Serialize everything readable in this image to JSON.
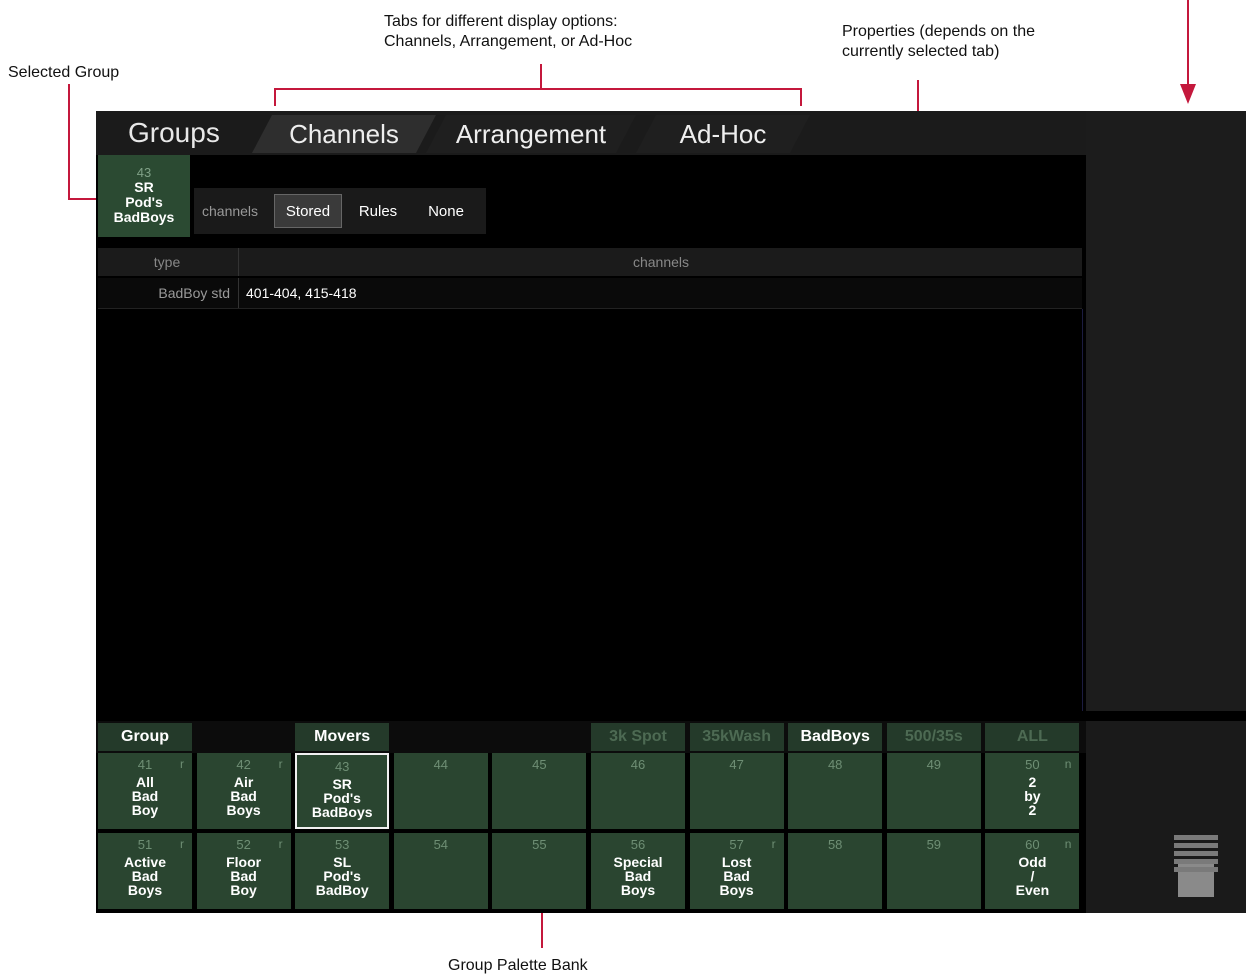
{
  "callouts": {
    "tabs_note_line1": "Tabs for different display options:",
    "tabs_note_line2": "Channels, Arrangement, or Ad-Hoc",
    "properties_note_line1": "Properties (depends on the",
    "properties_note_line2": "currently selected tab)",
    "selected_group_note": "Selected Group",
    "palette_bank_note": "Group Palette Bank"
  },
  "header": {
    "title": "Groups",
    "tabs": [
      {
        "label": "Channels",
        "active": true
      },
      {
        "label": "Arrangement",
        "active": false
      },
      {
        "label": "Ad-Hoc",
        "active": false
      }
    ]
  },
  "selected_group": {
    "number": "43",
    "name": "SR\nPod's\nBadBoys"
  },
  "channels_filter": {
    "label": "channels",
    "options": [
      {
        "label": "Stored",
        "selected": true
      },
      {
        "label": "Rules",
        "selected": false
      },
      {
        "label": "None",
        "selected": false
      }
    ]
  },
  "table": {
    "headers": [
      "type",
      "channels"
    ],
    "rows": [
      {
        "type": "BadBoy std",
        "channels": "401-404, 415-418"
      }
    ]
  },
  "bank_labels": [
    {
      "label": "Group",
      "dim": false
    },
    {
      "label": "",
      "dim": false
    },
    {
      "label": "Movers",
      "dim": false
    },
    {
      "label": "",
      "dim": false
    },
    {
      "label": "",
      "dim": false
    },
    {
      "label": "3k Spot",
      "dim": true
    },
    {
      "label": "35kWash",
      "dim": true
    },
    {
      "label": "BadBoys",
      "dim": false
    },
    {
      "label": "500/35s",
      "dim": true
    },
    {
      "label": "ALL",
      "dim": true
    }
  ],
  "palette": [
    {
      "num": "41",
      "flag": "r",
      "label": "All\nBad\nBoy"
    },
    {
      "num": "42",
      "flag": "r",
      "label": "Air\nBad\nBoys"
    },
    {
      "num": "43",
      "flag": "",
      "label": "SR\nPod's\nBadBoys",
      "selected": true
    },
    {
      "num": "44",
      "flag": "",
      "label": ""
    },
    {
      "num": "45",
      "flag": "",
      "label": ""
    },
    {
      "num": "46",
      "flag": "",
      "label": ""
    },
    {
      "num": "47",
      "flag": "",
      "label": ""
    },
    {
      "num": "48",
      "flag": "",
      "label": ""
    },
    {
      "num": "49",
      "flag": "",
      "label": ""
    },
    {
      "num": "50",
      "flag": "n",
      "label": "2\nby\n2"
    },
    {
      "num": "51",
      "flag": "r",
      "label": "Active\nBad\nBoys"
    },
    {
      "num": "52",
      "flag": "r",
      "label": "Floor\nBad\nBoy"
    },
    {
      "num": "53",
      "flag": "",
      "label": "SL\nPod's\nBadBoy"
    },
    {
      "num": "54",
      "flag": "",
      "label": ""
    },
    {
      "num": "55",
      "flag": "",
      "label": ""
    },
    {
      "num": "56",
      "flag": "",
      "label": "Special\nBad\nBoys"
    },
    {
      "num": "57",
      "flag": "r",
      "label": "Lost\nBad\nBoys"
    },
    {
      "num": "58",
      "flag": "",
      "label": ""
    },
    {
      "num": "59",
      "flag": "",
      "label": ""
    },
    {
      "num": "60",
      "flag": "n",
      "label": "Odd\n/\nEven"
    }
  ],
  "colors": {
    "accent_arrow": "#c4183c",
    "group_green": "#2a4530"
  }
}
